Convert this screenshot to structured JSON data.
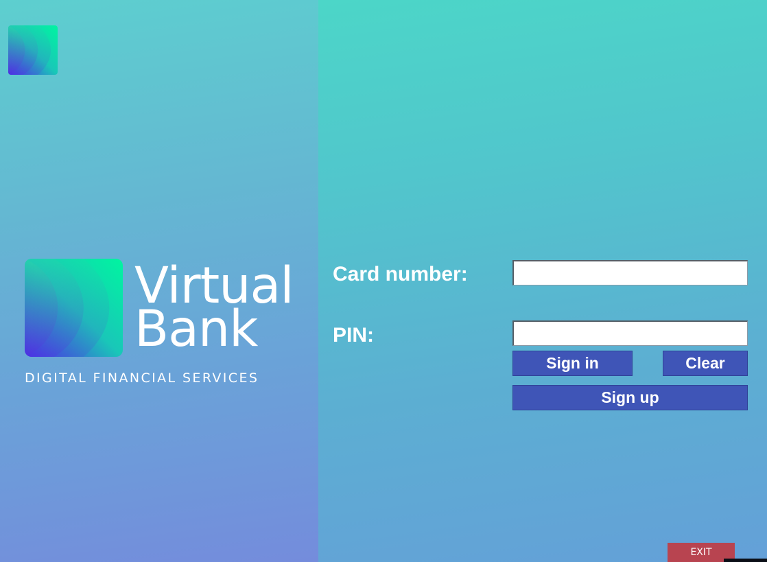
{
  "brand": {
    "name_line1": "Virtual",
    "name_line2": "Bank",
    "tagline": "DIGITAL FINANCIAL SERVICES",
    "logo_icon": "virtual-bank-logo-icon",
    "logo_colors": [
      "#00f5a0",
      "#1ad0b8",
      "#4a2ee8"
    ]
  },
  "login": {
    "card_label": "Card number:",
    "card_value": "",
    "pin_label": "PIN:",
    "pin_value": "",
    "sign_in_label": "Sign in",
    "clear_label": "Clear",
    "sign_up_label": "Sign up"
  },
  "exit_label": "EXIT",
  "colors": {
    "primary_button": "#3f55b7",
    "exit_button": "#b84450",
    "text": "#ffffff"
  }
}
